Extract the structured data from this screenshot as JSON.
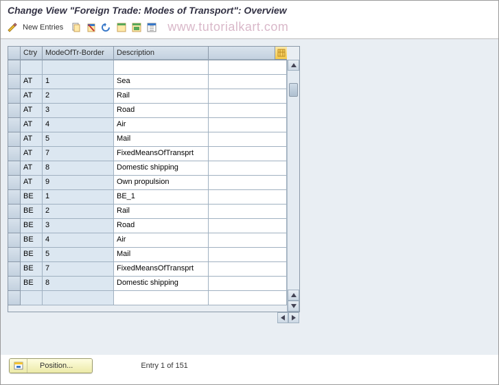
{
  "title": "Change View \"Foreign Trade: Modes of Transport\": Overview",
  "toolbar": {
    "new_entries": "New Entries"
  },
  "watermark": "www.tutorialkart.com",
  "table": {
    "headers": {
      "ctry": "Ctry",
      "mode": "ModeOfTr-Border",
      "desc": "Description"
    },
    "rows": [
      {
        "ctry": "",
        "mode": "",
        "desc": ""
      },
      {
        "ctry": "AT",
        "mode": "1",
        "desc": "Sea"
      },
      {
        "ctry": "AT",
        "mode": "2",
        "desc": "Rail"
      },
      {
        "ctry": "AT",
        "mode": "3",
        "desc": "Road"
      },
      {
        "ctry": "AT",
        "mode": "4",
        "desc": "Air"
      },
      {
        "ctry": "AT",
        "mode": "5",
        "desc": "Mail"
      },
      {
        "ctry": "AT",
        "mode": "7",
        "desc": "FixedMeansOfTransprt"
      },
      {
        "ctry": "AT",
        "mode": "8",
        "desc": "Domestic shipping"
      },
      {
        "ctry": "AT",
        "mode": "9",
        "desc": "Own propulsion"
      },
      {
        "ctry": "BE",
        "mode": "1",
        "desc": "BE_1"
      },
      {
        "ctry": "BE",
        "mode": "2",
        "desc": "Rail"
      },
      {
        "ctry": "BE",
        "mode": "3",
        "desc": "Road"
      },
      {
        "ctry": "BE",
        "mode": "4",
        "desc": "Air"
      },
      {
        "ctry": "BE",
        "mode": "5",
        "desc": "Mail"
      },
      {
        "ctry": "BE",
        "mode": "7",
        "desc": "FixedMeansOfTransprt"
      },
      {
        "ctry": "BE",
        "mode": "8",
        "desc": "Domestic shipping"
      },
      {
        "ctry": "",
        "mode": "",
        "desc": ""
      }
    ]
  },
  "footer": {
    "position_label": "Position...",
    "entry_text": "Entry 1 of 151"
  }
}
